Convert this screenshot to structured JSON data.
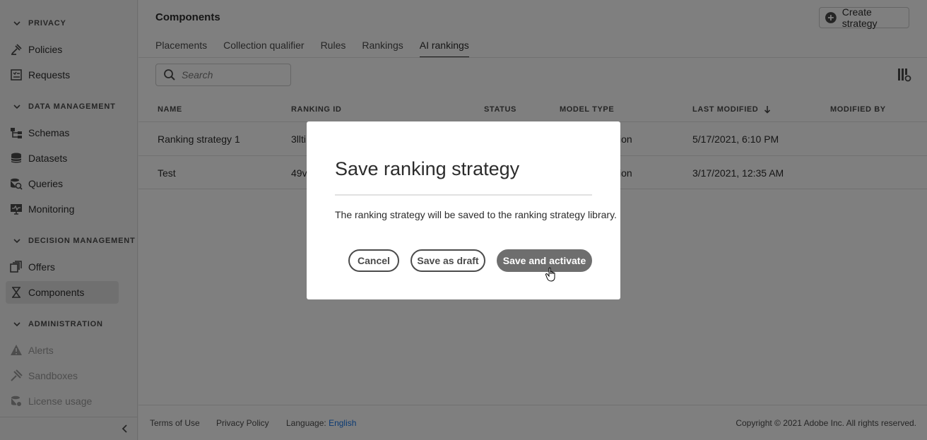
{
  "sidebar": {
    "sections": [
      {
        "label": "PRIVACY",
        "items": [
          {
            "label": "Policies",
            "icon": "policies-icon"
          },
          {
            "label": "Requests",
            "icon": "requests-icon"
          }
        ]
      },
      {
        "label": "DATA MANAGEMENT",
        "items": [
          {
            "label": "Schemas",
            "icon": "schemas-icon"
          },
          {
            "label": "Datasets",
            "icon": "datasets-icon"
          },
          {
            "label": "Queries",
            "icon": "queries-icon"
          },
          {
            "label": "Monitoring",
            "icon": "monitoring-icon"
          }
        ]
      },
      {
        "label": "DECISION MANAGEMENT",
        "items": [
          {
            "label": "Offers",
            "icon": "offers-icon"
          },
          {
            "label": "Components",
            "icon": "components-icon",
            "active": true
          }
        ]
      },
      {
        "label": "ADMINISTRATION",
        "items": [
          {
            "label": "Alerts",
            "icon": "alerts-icon",
            "disabled": true
          },
          {
            "label": "Sandboxes",
            "icon": "sandboxes-icon",
            "disabled": true
          },
          {
            "label": "License usage",
            "icon": "license-usage-icon",
            "disabled": true
          }
        ]
      }
    ]
  },
  "header": {
    "title": "Components",
    "create_button": "Create strategy"
  },
  "tabs": [
    {
      "label": "Placements"
    },
    {
      "label": "Collection qualifier"
    },
    {
      "label": "Rules"
    },
    {
      "label": "Rankings"
    },
    {
      "label": "AI rankings",
      "active": true
    }
  ],
  "search": {
    "placeholder": "Search",
    "value": ""
  },
  "table": {
    "columns": [
      "NAME",
      "RANKING ID",
      "STATUS",
      "MODEL TYPE",
      "LAST MODIFIED",
      "MODIFIED BY"
    ],
    "rows": [
      {
        "name": "Ranking strategy 1",
        "ranking_id": "3llti",
        "status": "",
        "model_type": "ion",
        "last_modified": "5/17/2021, 6:10 PM",
        "modified_by": ""
      },
      {
        "name": "Test",
        "ranking_id": "49v",
        "status": "",
        "model_type": "ion",
        "last_modified": "3/17/2021, 12:35 AM",
        "modified_by": ""
      }
    ]
  },
  "footer": {
    "terms": "Terms of Use",
    "privacy": "Privacy Policy",
    "language_label": "Language:",
    "language_value": "English",
    "copyright": "Copyright © 2021 Adobe Inc. All rights reserved."
  },
  "dialog": {
    "title": "Save ranking strategy",
    "body": "The ranking strategy will be saved to the ranking strategy library.",
    "cancel": "Cancel",
    "save_draft": "Save as draft",
    "save_activate": "Save and activate"
  },
  "colors": {
    "link": "#1473e6",
    "primary_button": "#6e6e6e",
    "overlay": "rgba(0,0,0,0.5)"
  }
}
